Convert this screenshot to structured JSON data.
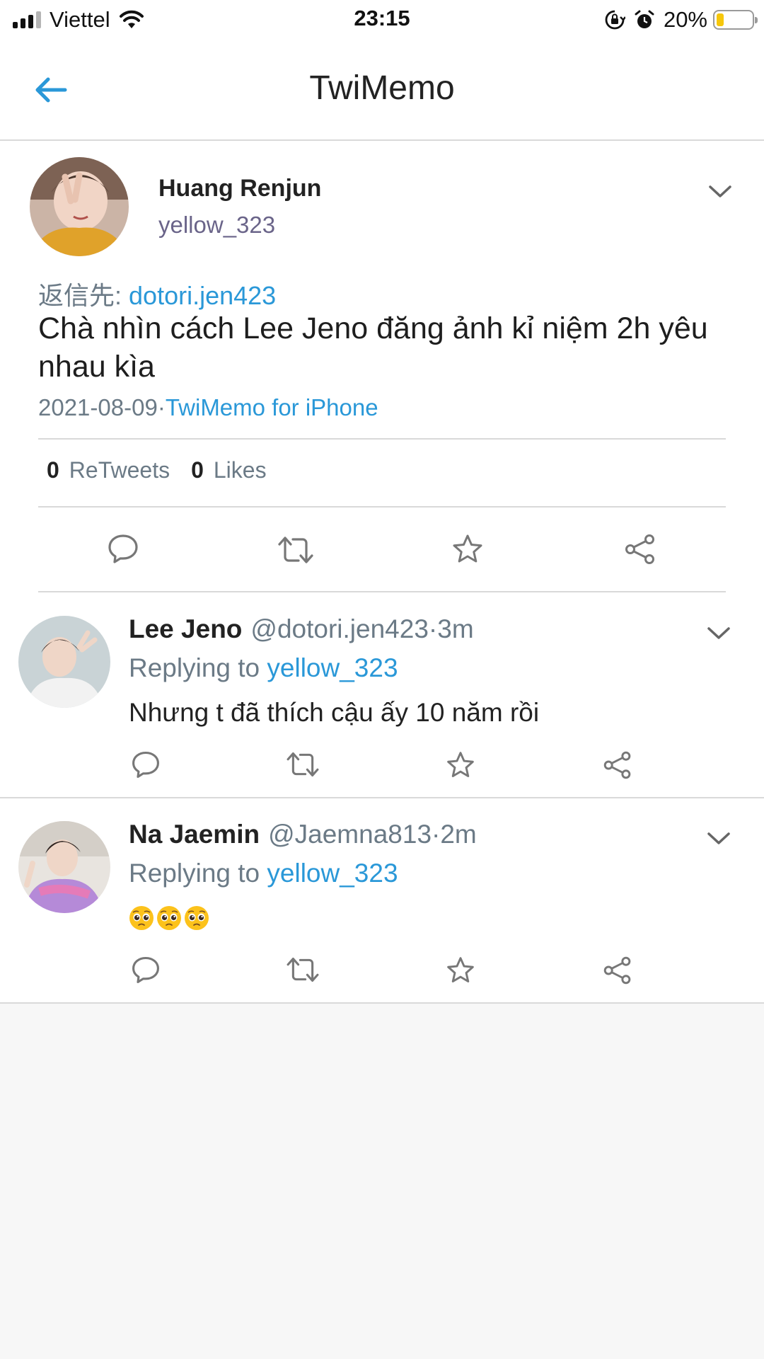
{
  "status_bar": {
    "carrier": "Viettel",
    "time": "23:15",
    "battery": "20%",
    "battery_level": 0.2,
    "battery_color": "#f6c70c"
  },
  "nav": {
    "title": "TwiMemo",
    "back_icon": "arrow-left-icon",
    "accent": "#2a98d8"
  },
  "main_tweet": {
    "name": "Huang Renjun",
    "handle": "yellow_323",
    "reply_prefix": "返信先:",
    "reply_to": "dotori.jen423",
    "text": "Chà nhìn cách Lee Jeno đăng ảnh kỉ niệm 2h yêu nhau kìa",
    "date": "2021-08-09",
    "separator": "·",
    "client": "TwiMemo for iPhone",
    "retweets_count": "0",
    "retweets_label": "ReTweets",
    "likes_count": "0",
    "likes_label": "Likes",
    "actions": [
      "reply-icon",
      "retweet-icon",
      "star-icon",
      "share-icon"
    ]
  },
  "replies": [
    {
      "name": "Lee Jeno",
      "handle": "@dotori.jen423",
      "time": "·3m",
      "replying_label": "Replying to",
      "replying_to": "yellow_323",
      "text": "Nhưng t đã thích cậu ấy 10 năm rồi"
    },
    {
      "name": "Na Jaemin",
      "handle": "@Jaemna813",
      "time": "·2m",
      "replying_label": "Replying to",
      "replying_to": "yellow_323",
      "emojis": [
        "pleading-face-emoji",
        "pleading-face-emoji",
        "pleading-face-emoji"
      ]
    }
  ]
}
